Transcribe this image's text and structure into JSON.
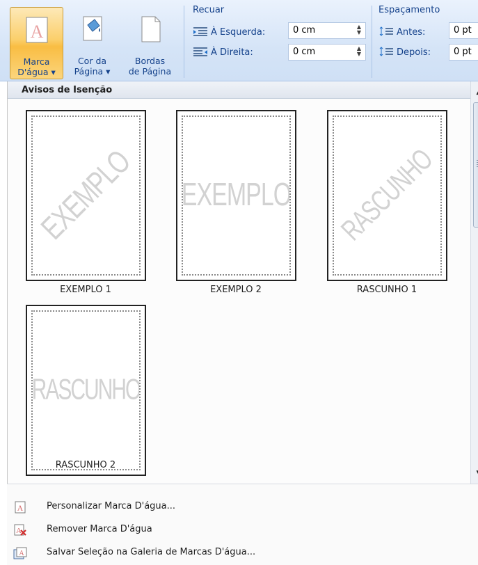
{
  "ribbon": {
    "buttons": [
      {
        "line1": "Marca",
        "line2": "D'água ▾",
        "icon": "watermark-icon"
      },
      {
        "line1": "Cor da",
        "line2": "Página ▾",
        "icon": "paint-bucket-icon"
      },
      {
        "line1": "Bordas",
        "line2": "de Página",
        "icon": "page-borders-icon"
      }
    ],
    "indent": {
      "title": "Recuar",
      "left_label": "À Esquerda:",
      "left_value": "0 cm",
      "right_label": "À Direita:",
      "right_value": "0 cm"
    },
    "spacing": {
      "title": "Espaçamento",
      "before_label": "Antes:",
      "before_value": "0 pt",
      "after_label": "Depois:",
      "after_value": "0 pt"
    }
  },
  "gallery": {
    "section_title": "Avisos de Isenção",
    "items": [
      {
        "caption": "EXEMPLO 1",
        "watermark": "EXEMPLO",
        "style": "diagonal"
      },
      {
        "caption": "EXEMPLO 2",
        "watermark": "EXEMPLO",
        "style": "horizontal"
      },
      {
        "caption": "RASCUNHO 1",
        "watermark": "RASCUNHO",
        "style": "diagonal"
      },
      {
        "caption": "RASCUNHO 2",
        "watermark": "RASCUNHO",
        "style": "horizontal"
      }
    ]
  },
  "menu": {
    "items": [
      {
        "label": "Personalizar Marca D'água...",
        "icon": "custom-watermark-icon"
      },
      {
        "label": "Remover Marca D'água",
        "icon": "remove-watermark-icon"
      },
      {
        "label": "Salvar Seleção na Galeria de Marcas D'água...",
        "icon": "save-to-gallery-icon"
      }
    ]
  },
  "colors": {
    "ribbon_text": "#15428b",
    "active_button": "#f9bd43",
    "watermark_gray": "#d2d2d2"
  }
}
